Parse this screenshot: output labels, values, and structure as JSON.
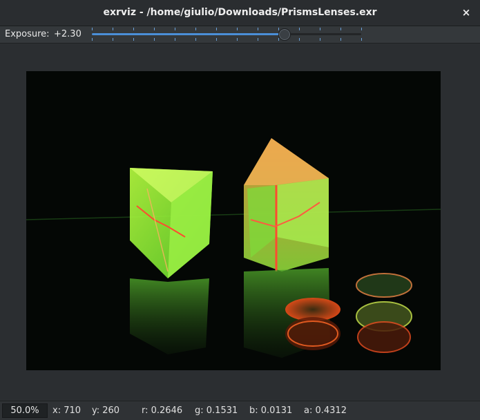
{
  "window": {
    "title": "exrviz - /home/giulio/Downloads/PrismsLenses.exr",
    "close_glyph": "×"
  },
  "toolbar": {
    "exposure_label": "Exposure:",
    "exposure_value": "+2.30",
    "exposure_fraction": 0.714
  },
  "image": {
    "icon": "exr-image-prisms-lenses"
  },
  "status": {
    "zoom": "50.0%",
    "x": "x: 710",
    "y": "y: 260",
    "r": "r: 0.2646",
    "g": "g: 0.1531",
    "b": "b: 0.0131",
    "a": "a: 0.4312"
  },
  "colors": {
    "accent": "#4b8fd8",
    "background": "#2b2e31",
    "titlebar": "#2a2d30"
  }
}
